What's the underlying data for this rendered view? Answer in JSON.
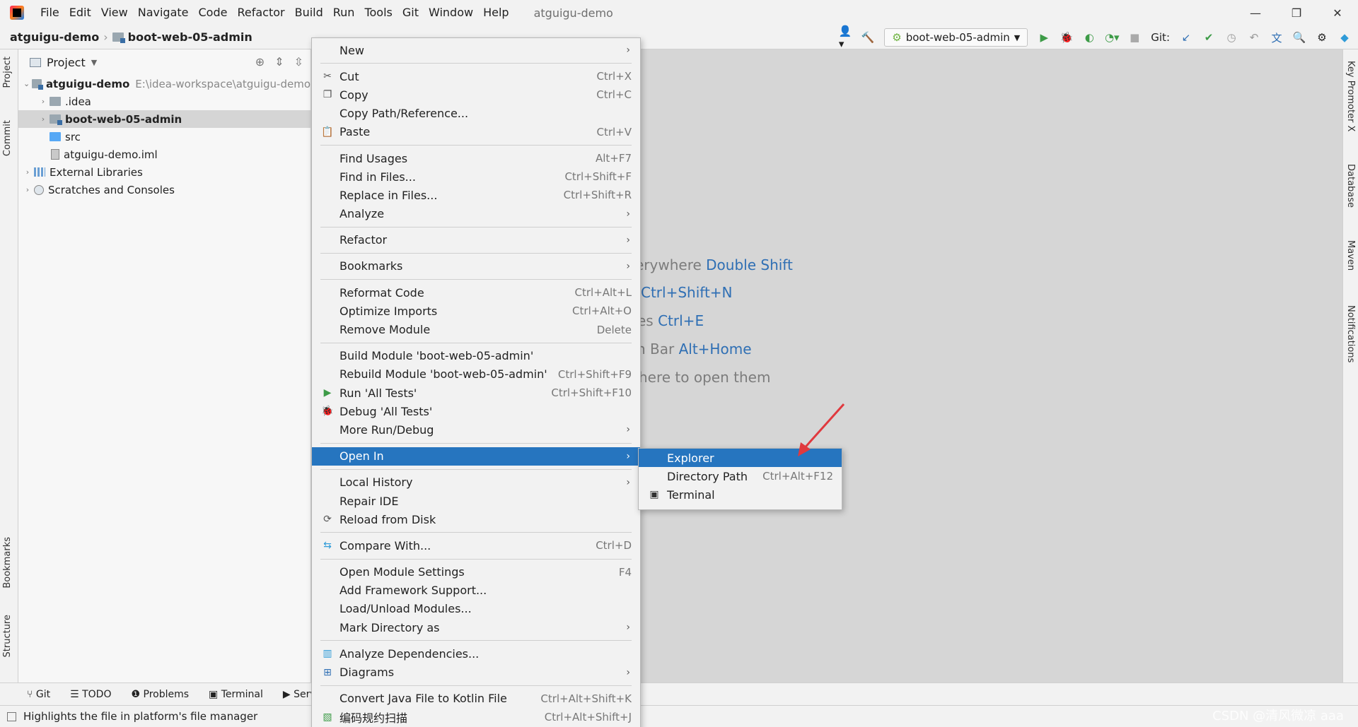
{
  "menubar": {
    "items": [
      "File",
      "Edit",
      "View",
      "Navigate",
      "Code",
      "Refactor",
      "Build",
      "Run",
      "Tools",
      "Git",
      "Window",
      "Help"
    ],
    "title": "atguigu-demo"
  },
  "toolbar": {
    "breadcrumb": [
      "atguigu-demo",
      "boot-web-05-admin"
    ],
    "run_config": "boot-web-05-admin",
    "git_label": "Git:"
  },
  "left_stripe": {
    "tabs": [
      "Project",
      "Commit",
      "Bookmarks",
      "Structure"
    ]
  },
  "right_stripe": {
    "tabs": [
      "Key Promoter X",
      "Database",
      "Maven",
      "Notifications"
    ]
  },
  "project_panel": {
    "title": "Project",
    "tree": [
      {
        "label": "atguigu-demo",
        "path": "E:\\idea-workspace\\atguigu-demo"
      },
      {
        "label": ".idea"
      },
      {
        "label": "boot-web-05-admin"
      },
      {
        "label": "src"
      },
      {
        "label": "atguigu-demo.iml"
      },
      {
        "label": "External Libraries"
      },
      {
        "label": "Scratches and Consoles"
      }
    ]
  },
  "editor_hints": [
    {
      "text": "erywhere ",
      "key": "Double Shift"
    },
    {
      "text": "",
      "key": "Ctrl+Shift+N"
    },
    {
      "text": "es ",
      "key": "Ctrl+E"
    },
    {
      "text": "n Bar ",
      "key": "Alt+Home"
    },
    {
      "text": "here to open them",
      "key": ""
    }
  ],
  "context_menu": {
    "groups": [
      [
        {
          "label": "New",
          "sub": true
        }
      ],
      [
        {
          "label": "Cut",
          "shortcut": "Ctrl+X",
          "icon": "scissors"
        },
        {
          "label": "Copy",
          "shortcut": "Ctrl+C",
          "icon": "copy"
        },
        {
          "label": "Copy Path/Reference..."
        },
        {
          "label": "Paste",
          "shortcut": "Ctrl+V",
          "icon": "paste"
        }
      ],
      [
        {
          "label": "Find Usages",
          "shortcut": "Alt+F7"
        },
        {
          "label": "Find in Files...",
          "shortcut": "Ctrl+Shift+F"
        },
        {
          "label": "Replace in Files...",
          "shortcut": "Ctrl+Shift+R"
        },
        {
          "label": "Analyze",
          "sub": true
        }
      ],
      [
        {
          "label": "Refactor",
          "sub": true
        }
      ],
      [
        {
          "label": "Bookmarks",
          "sub": true
        }
      ],
      [
        {
          "label": "Reformat Code",
          "shortcut": "Ctrl+Alt+L"
        },
        {
          "label": "Optimize Imports",
          "shortcut": "Ctrl+Alt+O"
        },
        {
          "label": "Remove Module",
          "shortcut": "Delete"
        }
      ],
      [
        {
          "label": "Build Module 'boot-web-05-admin'"
        },
        {
          "label": "Rebuild Module 'boot-web-05-admin'",
          "shortcut": "Ctrl+Shift+F9"
        },
        {
          "label": "Run 'All Tests'",
          "shortcut": "Ctrl+Shift+F10",
          "icon": "run"
        },
        {
          "label": "Debug 'All Tests'",
          "icon": "debug"
        },
        {
          "label": "More Run/Debug",
          "sub": true
        }
      ],
      [
        {
          "label": "Open In",
          "sub": true,
          "active": true
        }
      ],
      [
        {
          "label": "Local History",
          "sub": true
        },
        {
          "label": "Repair IDE"
        },
        {
          "label": "Reload from Disk",
          "icon": "reload"
        }
      ],
      [
        {
          "label": "Compare With...",
          "shortcut": "Ctrl+D",
          "icon": "compare"
        }
      ],
      [
        {
          "label": "Open Module Settings",
          "shortcut": "F4"
        },
        {
          "label": "Add Framework Support..."
        },
        {
          "label": "Load/Unload Modules..."
        },
        {
          "label": "Mark Directory as",
          "sub": true
        }
      ],
      [
        {
          "label": "Analyze Dependencies...",
          "icon": "analyze"
        },
        {
          "label": "Diagrams",
          "sub": true,
          "icon": "diagram"
        }
      ],
      [
        {
          "label": "Convert Java File to Kotlin File",
          "shortcut": "Ctrl+Alt+Shift+K"
        },
        {
          "label": "编码规约扫描",
          "shortcut": "Ctrl+Alt+Shift+J",
          "icon": "scan"
        }
      ]
    ]
  },
  "submenu": {
    "items": [
      {
        "label": "Explorer",
        "active": true
      },
      {
        "label": "Directory Path",
        "shortcut": "Ctrl+Alt+F12"
      },
      {
        "label": "Terminal",
        "icon": "terminal"
      }
    ]
  },
  "bottom_tabs": [
    "Git",
    "TODO",
    "Problems",
    "Terminal",
    "Servi"
  ],
  "status": {
    "text": "Highlights the file in platform's file manager"
  },
  "watermark": "CSDN @清风微凉 aaa",
  "colors": {
    "selection": "#2675bf",
    "annotation_arrow": "#e0393e",
    "link": "#2f6fb4"
  }
}
